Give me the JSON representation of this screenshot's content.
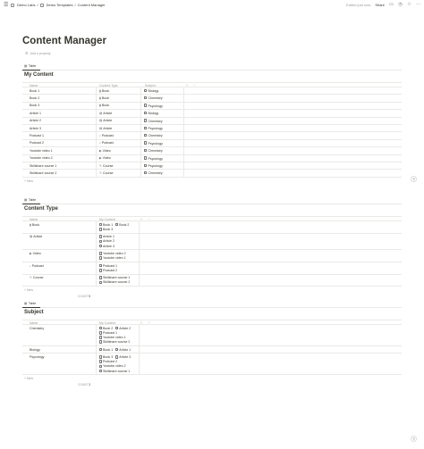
{
  "topbar": {
    "breadcrumbs": [
      "Demo Labs",
      "Demo Templates",
      "Content Manager"
    ],
    "edited": "Edited just now",
    "share": "Share"
  },
  "page": {
    "title": "Content Manager",
    "add_property": "Add a property"
  },
  "view_tab_label": "Table",
  "new_label": "New",
  "count_label": "COUNT",
  "content": {
    "title": "My Content",
    "headers": [
      "Name",
      "Content Type",
      "Subject"
    ],
    "rows": [
      {
        "name": "Book 1",
        "type": "Book",
        "subject": "Biology"
      },
      {
        "name": "Book 2",
        "type": "Book",
        "subject": "Chemistry"
      },
      {
        "name": "Book 3",
        "type": "Book",
        "subject": "Psycology"
      },
      {
        "name": "Article 1",
        "type": "Article",
        "subject": "Biology"
      },
      {
        "name": "Article 2",
        "type": "Article",
        "subject": "Chemistry"
      },
      {
        "name": "Article 3",
        "type": "Article",
        "subject": "Psycology"
      },
      {
        "name": "Podcast 1",
        "type": "Podcast",
        "subject": "Chemistry"
      },
      {
        "name": "Podcast 2",
        "type": "Podcast",
        "subject": "Psycology"
      },
      {
        "name": "Youtube video 1",
        "type": "Video",
        "subject": "Chemistry"
      },
      {
        "name": "Youtube video 2",
        "type": "Video",
        "subject": "Psycology"
      },
      {
        "name": "Skillshare course 1",
        "type": "Course",
        "subject": "Psycology"
      },
      {
        "name": "Skillshare course 2",
        "type": "Course",
        "subject": "Chemistry"
      }
    ]
  },
  "types": {
    "title": "Content Type",
    "headers": [
      "Name",
      "My Content"
    ],
    "count": "5",
    "rows": [
      {
        "name": "Book",
        "items": [
          [
            "Book 1",
            "Book 2"
          ],
          [
            "Book 3"
          ]
        ]
      },
      {
        "name": "Article",
        "items": [
          [
            "Article 1"
          ],
          [
            "Article 2"
          ],
          [
            "Article 3"
          ]
        ]
      },
      {
        "name": "Video",
        "items": [
          [
            "Youtube video 2"
          ],
          [
            "Youtube video 1"
          ]
        ]
      },
      {
        "name": "Podcast",
        "items": [
          [
            "Podcast 1"
          ],
          [
            "Podcast 2"
          ]
        ]
      },
      {
        "name": "Course",
        "items": [
          [
            "Skillshare course 1"
          ],
          [
            "Skillshare course 2"
          ]
        ]
      }
    ]
  },
  "subjects": {
    "title": "Subject",
    "headers": [
      "Name",
      "My Content"
    ],
    "count": "3",
    "rows": [
      {
        "name": "Chemistry",
        "items": [
          [
            "Book 2",
            "Article 2"
          ],
          [
            "Podcast 1"
          ],
          [
            "Youtube video 1"
          ],
          [
            "Skillshare course 2"
          ]
        ]
      },
      {
        "name": "Biology",
        "items": [
          [
            "Book 1",
            "Article 1"
          ]
        ]
      },
      {
        "name": "Psycology",
        "items": [
          [
            "Book 3",
            "Article 3"
          ],
          [
            "Podcast 2"
          ],
          [
            "Youtube video 2"
          ],
          [
            "Skillshare course 1"
          ]
        ]
      }
    ]
  }
}
